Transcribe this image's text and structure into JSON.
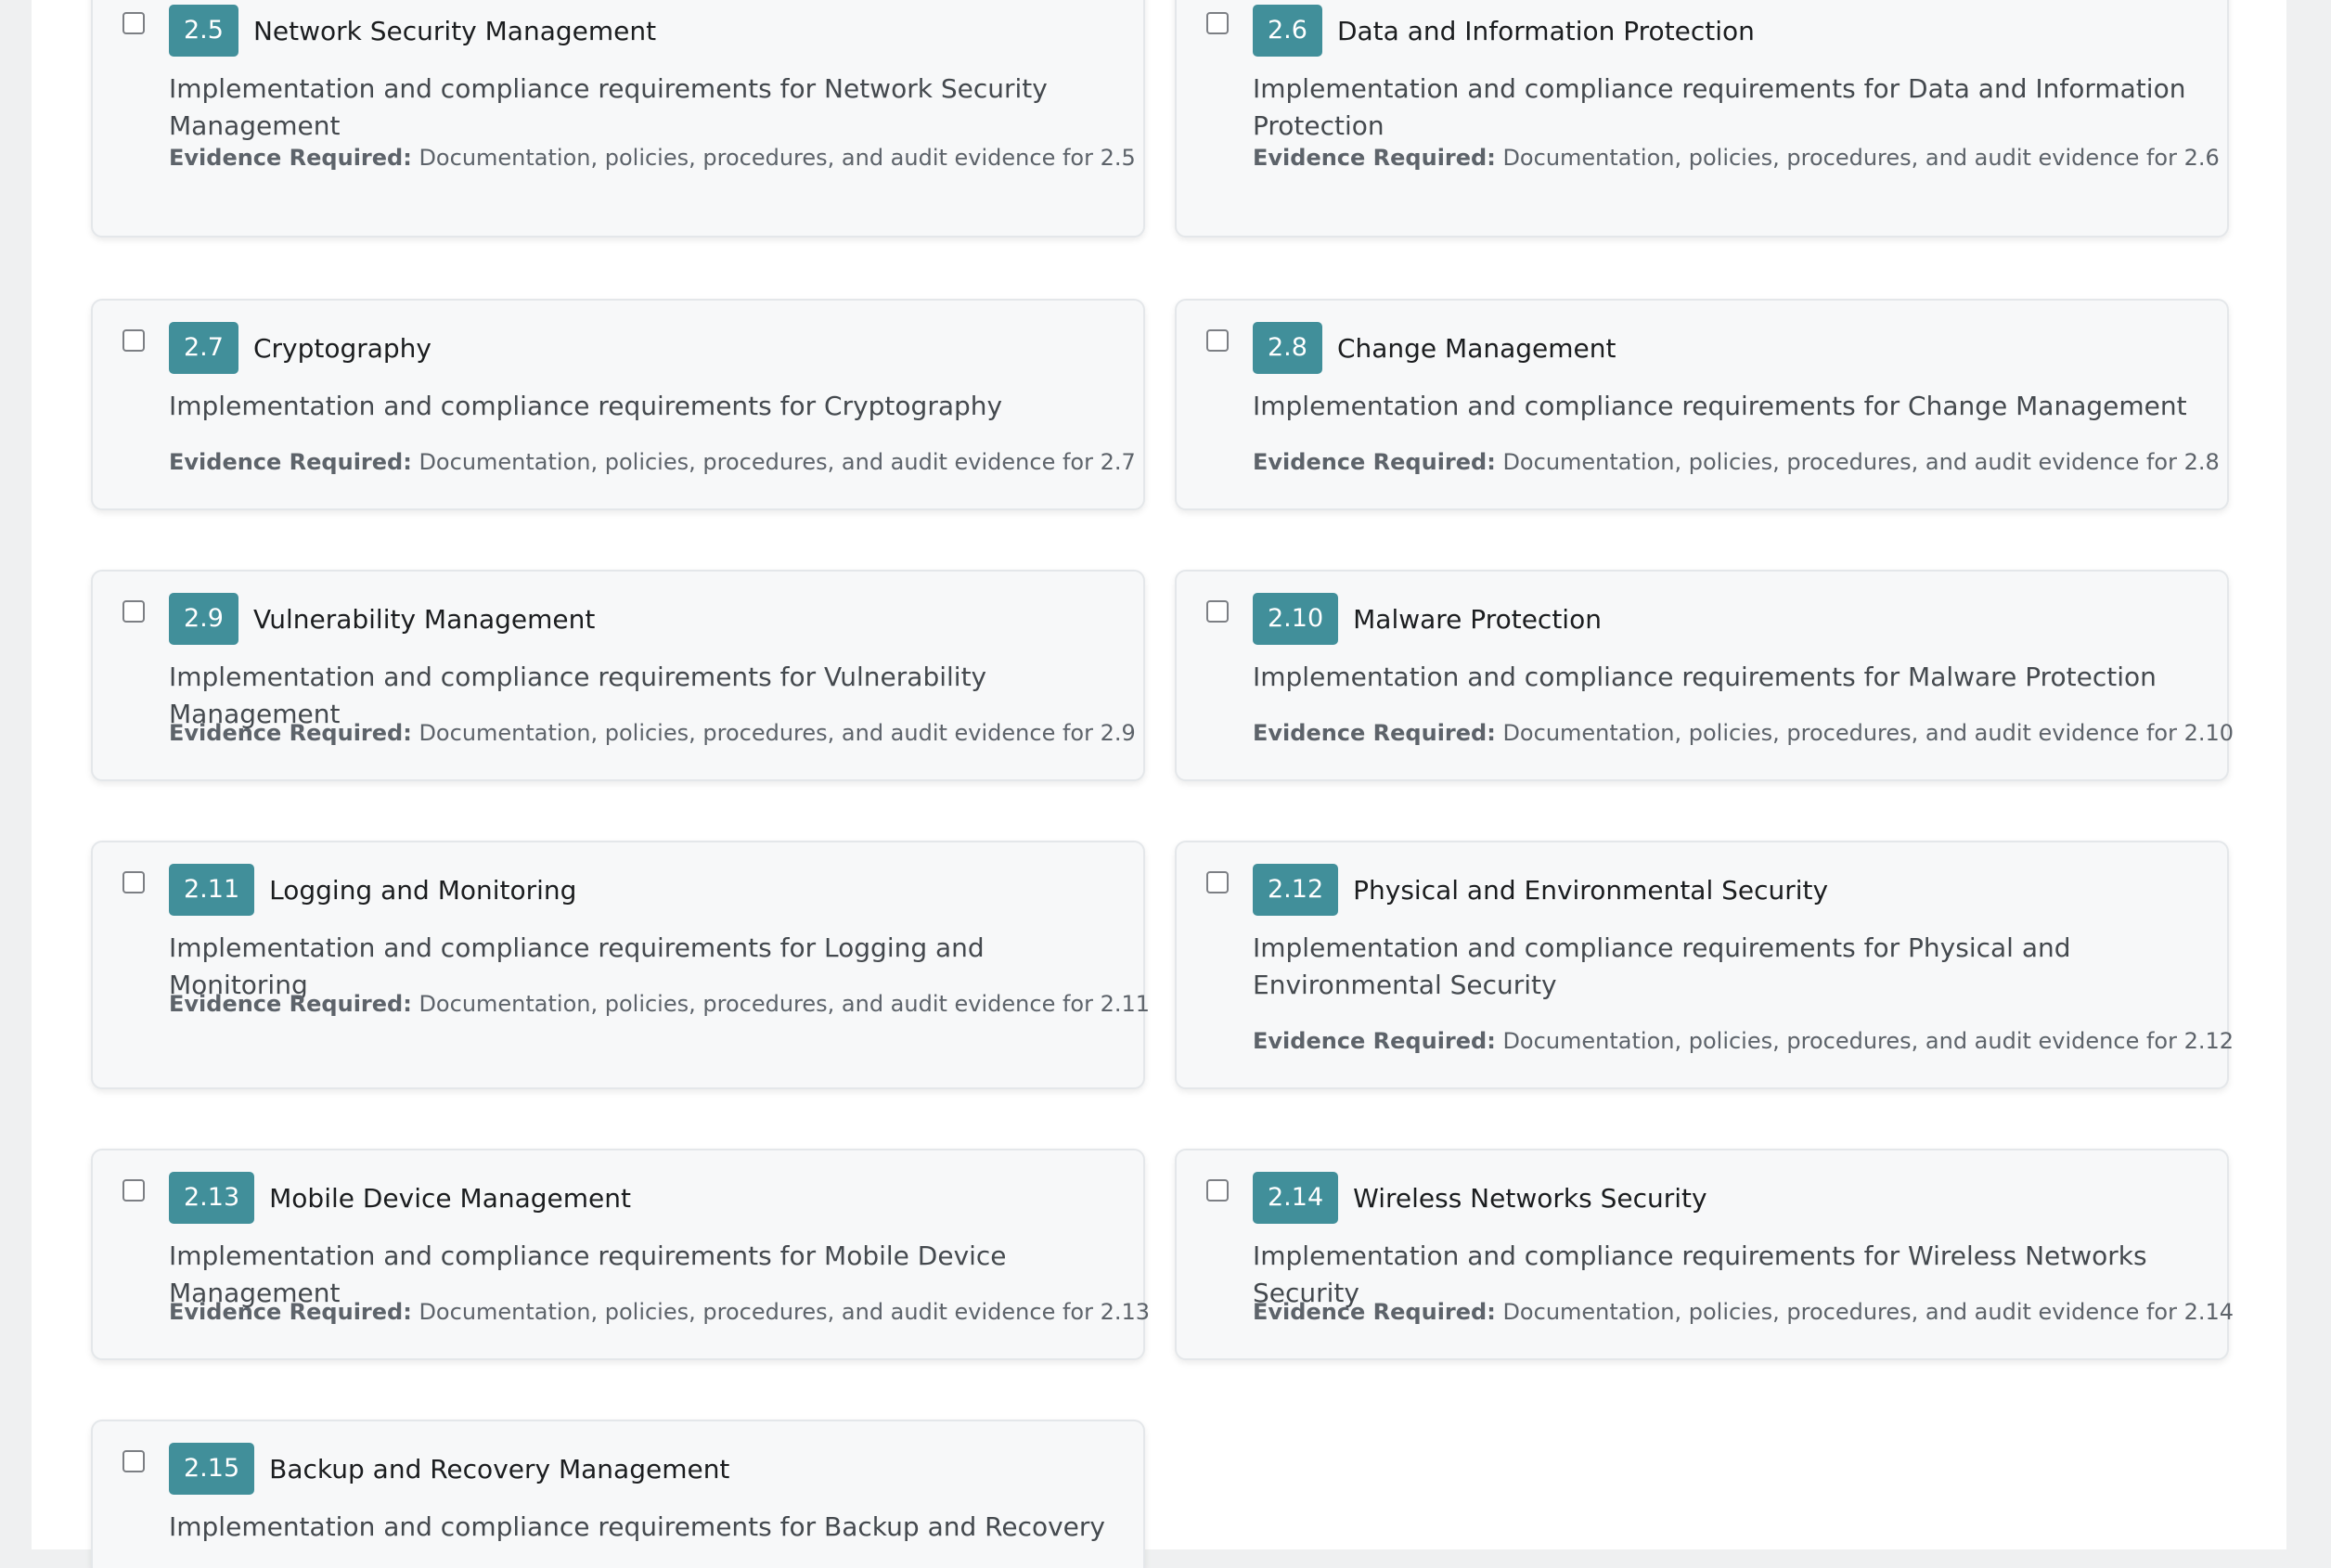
{
  "requirements": [
    {
      "id": "2.5",
      "title": "Network Security Management",
      "description": "Implementation and compliance requirements for Network Security Management",
      "evidence_label": "Evidence Required:",
      "evidence_text": "Documentation, policies, procedures, and audit evidence for 2.5",
      "checked": false
    },
    {
      "id": "2.6",
      "title": "Data and Information Protection",
      "description": "Implementation and compliance requirements for Data and Information Protection",
      "evidence_label": "Evidence Required:",
      "evidence_text": "Documentation, policies, procedures, and audit evidence for 2.6",
      "checked": false
    },
    {
      "id": "2.7",
      "title": "Cryptography",
      "description": "Implementation and compliance requirements for Cryptography",
      "evidence_label": "Evidence Required:",
      "evidence_text": "Documentation, policies, procedures, and audit evidence for 2.7",
      "checked": false
    },
    {
      "id": "2.8",
      "title": "Change Management",
      "description": "Implementation and compliance requirements for Change Management",
      "evidence_label": "Evidence Required:",
      "evidence_text": "Documentation, policies, procedures, and audit evidence for 2.8",
      "checked": false
    },
    {
      "id": "2.9",
      "title": "Vulnerability Management",
      "description": "Implementation and compliance requirements for Vulnerability Management",
      "evidence_label": "Evidence Required:",
      "evidence_text": "Documentation, policies, procedures, and audit evidence for 2.9",
      "checked": false
    },
    {
      "id": "2.10",
      "title": "Malware Protection",
      "description": "Implementation and compliance requirements for Malware Protection",
      "evidence_label": "Evidence Required:",
      "evidence_text": "Documentation, policies, procedures, and audit evidence for 2.10",
      "checked": false
    },
    {
      "id": "2.11",
      "title": "Logging and Monitoring",
      "description": "Implementation and compliance requirements for Logging and Monitoring",
      "evidence_label": "Evidence Required:",
      "evidence_text": "Documentation, policies, procedures, and audit evidence for 2.11",
      "checked": false
    },
    {
      "id": "2.12",
      "title": "Physical and Environmental Security",
      "description": "Implementation and compliance requirements for Physical and Environmental Security",
      "evidence_label": "Evidence Required:",
      "evidence_text": "Documentation, policies, procedures, and audit evidence for 2.12",
      "checked": false
    },
    {
      "id": "2.13",
      "title": "Mobile Device Management",
      "description": "Implementation and compliance requirements for Mobile Device Management",
      "evidence_label": "Evidence Required:",
      "evidence_text": "Documentation, policies, procedures, and audit evidence for 2.13",
      "checked": false
    },
    {
      "id": "2.14",
      "title": "Wireless Networks Security",
      "description": "Implementation and compliance requirements for Wireless Networks Security",
      "evidence_label": "Evidence Required:",
      "evidence_text": "Documentation, policies, procedures, and audit evidence for 2.14",
      "checked": false
    },
    {
      "id": "2.15",
      "title": "Backup and Recovery Management",
      "description": "Implementation and compliance requirements for Backup and Recovery",
      "evidence_label": "",
      "evidence_text": "",
      "checked": false
    }
  ],
  "colors": {
    "badge": "#418f9a",
    "card_background": "#f7f8f9",
    "page_background": "#eff0f1"
  }
}
